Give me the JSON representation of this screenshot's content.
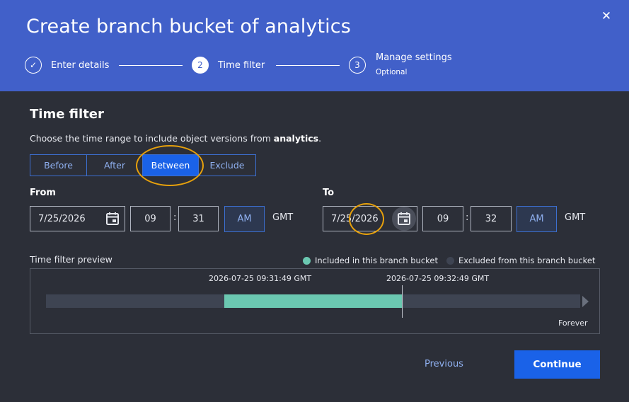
{
  "header": {
    "title": "Create branch bucket of analytics",
    "close_glyph": "✕"
  },
  "steps": [
    {
      "label": "Enter details",
      "indicator": "✓",
      "state": "complete"
    },
    {
      "label": "Time filter",
      "indicator": "2",
      "state": "active"
    },
    {
      "label": "Manage settings",
      "indicator": "3",
      "state": "upcoming",
      "sublabel": "Optional"
    }
  ],
  "section": {
    "title": "Time filter",
    "description_prefix": "Choose the time range to include object versions from ",
    "description_bucket": "analytics",
    "description_suffix": "."
  },
  "mode_options": [
    {
      "label": "Before",
      "selected": false
    },
    {
      "label": "After",
      "selected": false
    },
    {
      "label": "Between",
      "selected": true
    },
    {
      "label": "Exclude",
      "selected": false
    }
  ],
  "from": {
    "label": "From",
    "date": "7/25/2026",
    "hour": "09",
    "minute": "31",
    "ampm": "AM",
    "timezone": "GMT",
    "separator": ":"
  },
  "to": {
    "label": "To",
    "date": "7/25/2026",
    "hour": "09",
    "minute": "32",
    "ampm": "AM",
    "timezone": "GMT",
    "separator": ":"
  },
  "preview": {
    "title": "Time filter preview",
    "legend_included": "Included in this branch bucket",
    "legend_excluded": "Excluded from this branch bucket",
    "start_label": "2026-07-25 09:31:49 GMT",
    "end_label": "2026-07-25 09:32:49 GMT",
    "end_label_right": "Forever"
  },
  "footer": {
    "previous_label": "Previous",
    "continue_label": "Continue"
  },
  "colors": {
    "header_bg": "#4160c9",
    "body_bg": "#2c2f38",
    "primary": "#1a62e8",
    "included": "#6bc8b1",
    "excluded": "#3e4452",
    "highlight_ring": "#e7a10c"
  },
  "icons": {
    "close": "close-icon",
    "check": "check-icon",
    "calendar": "calendar-icon"
  }
}
